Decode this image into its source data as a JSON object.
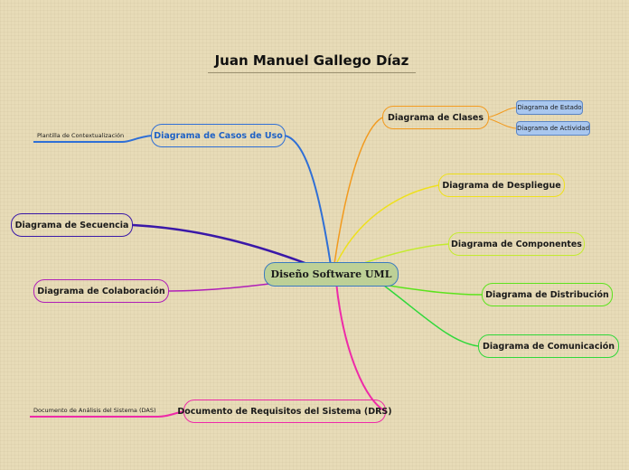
{
  "title": "Juan Manuel Gallego Díaz",
  "central": "Diseño Software UML",
  "nodes": {
    "casos_uso": "Diagrama de Casos de Uso",
    "secuencia": "Diagrama de Secuencia",
    "colaboracion": "Diagrama de Colaboración",
    "drs": "Documento de Requisitos del Sistema (DRS)",
    "clases": "Diagrama de Clases",
    "despliegue": "Diagrama de Despliegue",
    "componentes": "Diagrama de Componentes",
    "distribucion": "Diagrama de Distribución",
    "comunicacion": "Diagrama de Comunicación"
  },
  "subnodes": {
    "estado": "Diagrama de Estado",
    "actividad": "Diagrama de Actividad"
  },
  "leaves": {
    "plantilla": "Plantilla de Contextualización",
    "das": "Documento de Análisis del Sistema (DAS)"
  },
  "colors": {
    "casos_uso": "#2f6fd6",
    "secuencia": "#3a18a8",
    "colaboracion": "#b01eb8",
    "drs": "#ee2aa8",
    "clases": "#f29a1e",
    "despliegue": "#eee01c",
    "componentes": "#c4eb30",
    "distribucion": "#5ce31c",
    "comunicacion": "#30d83a"
  }
}
